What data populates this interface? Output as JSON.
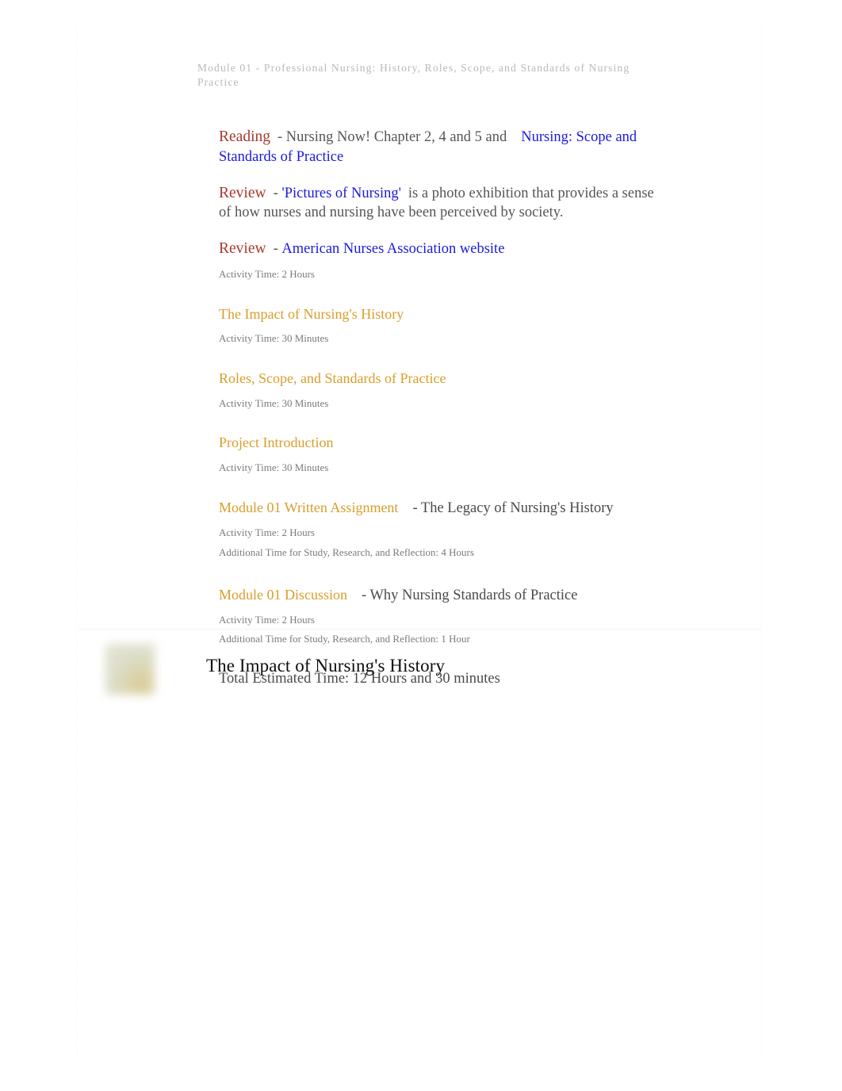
{
  "document": {
    "running_head": "Module 01 - Professional Nursing: History, Roles, Scope, and Standards of Nursing Practice"
  },
  "colors": {
    "keyword_red": "#a8392c",
    "link_blue": "#1a1ae0",
    "section_orange": "#d99e2b",
    "body_gray": "#555555",
    "meta_gray": "#7b7b7b",
    "running_head_gray": "#b9b9b9",
    "heading_black": "#0d0d0d",
    "thumbnail_sage": "#dcddc8",
    "thumbnail_olive": "#d6c88c",
    "page_white": "#ffffff"
  },
  "entries": {
    "reading": {
      "keyword": "Reading",
      "dash_text": "- Nursing Now!  Chapter 2, 4 and 5 and",
      "link": "Nursing: Scope and Standards of Practice"
    },
    "review_pictures": {
      "keyword": "Review",
      "dash": "-",
      "link": "'Pictures of Nursing'",
      "body": "is a photo exhibition that provides a sense of how nurses and nursing have been perceived by society."
    },
    "review_ana": {
      "keyword": "Review",
      "dash": "-",
      "link": "American Nurses Association website",
      "activity_time": "Activity Time: 2 Hours"
    },
    "impact_history": {
      "title": "The Impact of Nursing's History",
      "activity_time": "Activity Time: 30 Minutes"
    },
    "roles_scope": {
      "title": "Roles, Scope, and Standards of Practice",
      "activity_time": "Activity Time: 30 Minutes"
    },
    "project_intro": {
      "title": "Project Introduction",
      "activity_time": "Activity Time: 30 Minutes"
    },
    "written_assignment": {
      "title": "Module 01 Written Assignment",
      "suffix": "- The Legacy of Nursing's History",
      "activity_time": "Activity Time: 2 Hours",
      "additional_time": "Additional Time for Study, Research, and Reflection: 4 Hours"
    },
    "discussion": {
      "title": "Module 01 Discussion",
      "suffix": "- Why Nursing Standards of Practice",
      "activity_time": "Activity Time: 2 Hours",
      "additional_time": "Additional Time for Study, Research, and Reflection: 1 Hour"
    },
    "total": {
      "text": "Total Estimated Time: 12 Hours and 30 minutes"
    }
  },
  "second_page": {
    "thumbnail_name": "blurred-sage-photo",
    "heading": "The Impact of Nursing's History"
  }
}
